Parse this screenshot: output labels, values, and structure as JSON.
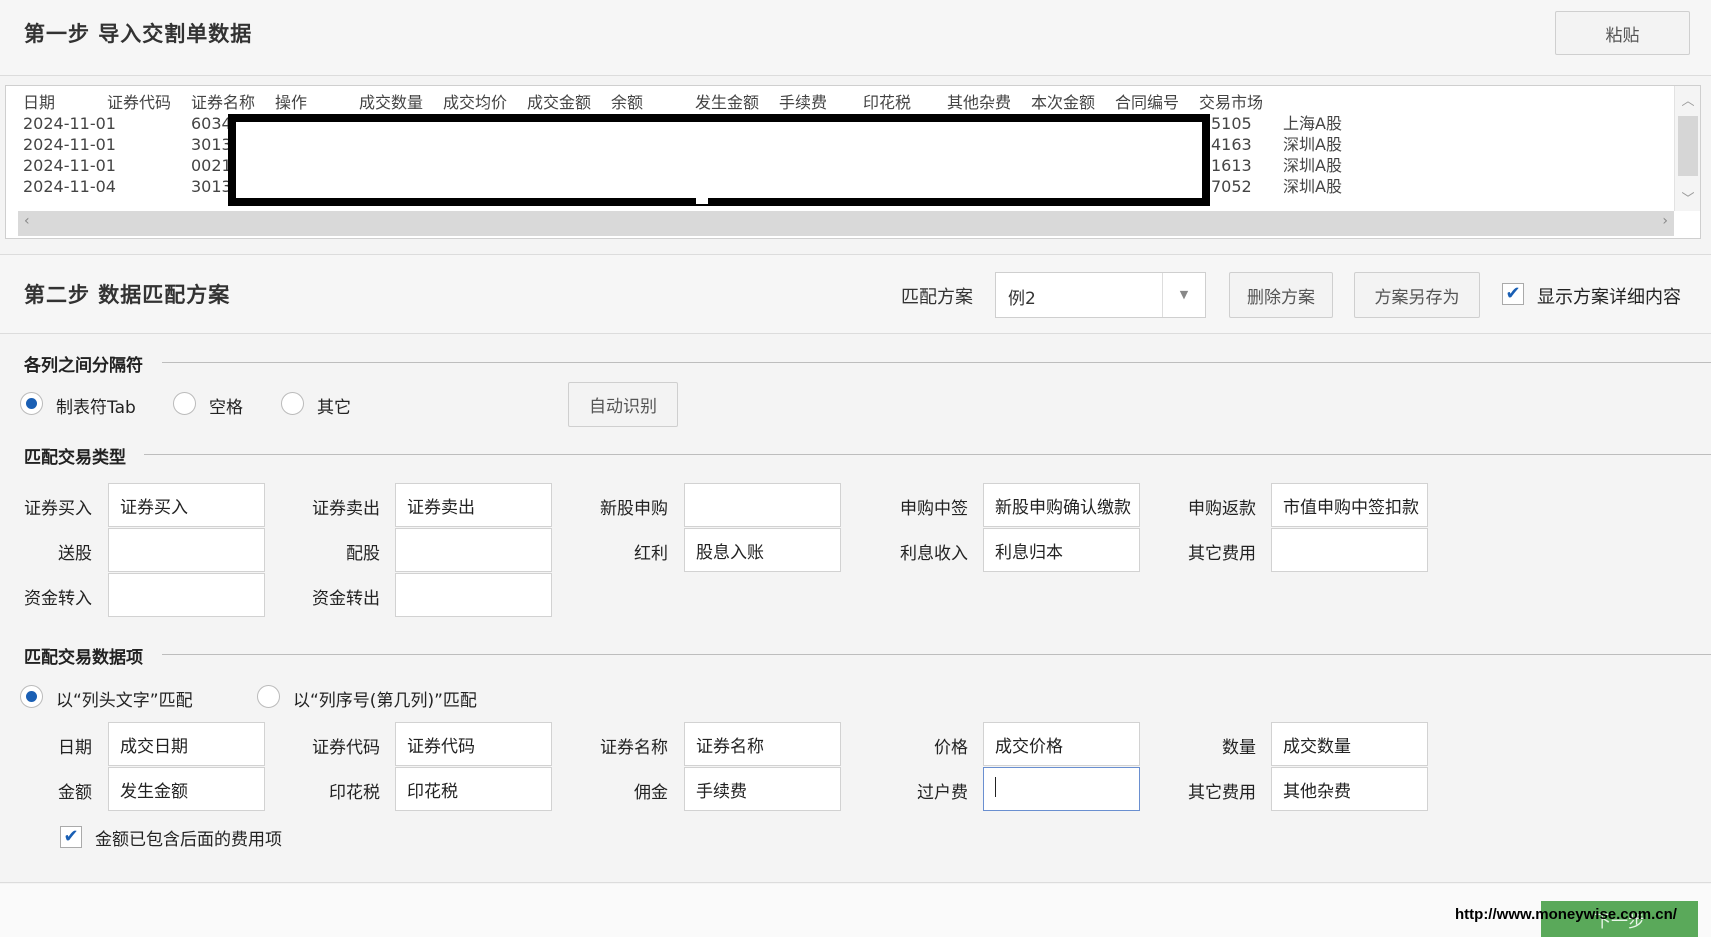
{
  "step1": {
    "title": "第一步 导入交割单数据",
    "paste_label": "粘贴",
    "columns": [
      "日期",
      "证券代码",
      "证券名称",
      "操作",
      "成交数量",
      "成交均价",
      "成交金额",
      "余额",
      "发生金额",
      "手续费",
      "印花税",
      "其他杂费",
      "本次金额",
      "合同编号",
      "交易市场"
    ],
    "rows": [
      {
        "date": "2024-11-01",
        "code": "6034",
        "contract": "5105",
        "market": "上海A股"
      },
      {
        "date": "2024-11-01",
        "code": "3013",
        "contract": "4163",
        "market": "深圳A股"
      },
      {
        "date": "2024-11-01",
        "code": "0021",
        "contract": "1613",
        "market": "深圳A股"
      },
      {
        "date": "2024-11-04",
        "code": "3013",
        "contract": "7052",
        "market": "深圳A股"
      }
    ]
  },
  "step2": {
    "title": "第二步 数据匹配方案",
    "scheme_label": "匹配方案",
    "scheme_value": "例2",
    "delete_label": "删除方案",
    "saveas_label": "方案另存为",
    "show_detail_label": "显示方案详细内容",
    "show_detail_checked": true
  },
  "separator": {
    "title": "各列之间分隔符",
    "options": [
      "制表符Tab",
      "空格",
      "其它"
    ],
    "selected": "制表符Tab",
    "auto_label": "自动识别"
  },
  "trade_types": {
    "title": "匹配交易类型",
    "fields": [
      {
        "label": "证券买入",
        "value": "证券买入"
      },
      {
        "label": "证券卖出",
        "value": "证券卖出"
      },
      {
        "label": "新股申购",
        "value": ""
      },
      {
        "label": "申购中签",
        "value": "新股申购确认缴款"
      },
      {
        "label": "申购返款",
        "value": "市值申购中签扣款"
      },
      {
        "label": "送股",
        "value": ""
      },
      {
        "label": "配股",
        "value": ""
      },
      {
        "label": "红利",
        "value": "股息入账"
      },
      {
        "label": "利息收入",
        "value": "利息归本"
      },
      {
        "label": "其它费用",
        "value": ""
      },
      {
        "label": "资金转入",
        "value": ""
      },
      {
        "label": "资金转出",
        "value": ""
      }
    ]
  },
  "data_items": {
    "title": "匹配交易数据项",
    "options": [
      "以“列头文字”匹配",
      "以“列序号(第几列)”匹配"
    ],
    "selected": "以“列头文字”匹配",
    "fields": [
      {
        "label": "日期",
        "value": "成交日期"
      },
      {
        "label": "证券代码",
        "value": "证券代码"
      },
      {
        "label": "证券名称",
        "value": "证券名称"
      },
      {
        "label": "价格",
        "value": "成交价格"
      },
      {
        "label": "数量",
        "value": "成交数量"
      },
      {
        "label": "金额",
        "value": "发生金额"
      },
      {
        "label": "印花税",
        "value": "印花税"
      },
      {
        "label": "佣金",
        "value": "手续费"
      },
      {
        "label": "过户费",
        "value": ""
      },
      {
        "label": "其它费用",
        "value": "其他杂费"
      }
    ],
    "include_fees_label": "金额已包含后面的费用项",
    "include_fees_checked": true
  },
  "footer": {
    "next_label": "下一步",
    "watermark": "http://www.moneywise.com.cn/"
  },
  "icons": {
    "scroll_up": "chevron-up-icon",
    "scroll_down": "chevron-down-icon",
    "scroll_left": "chevron-left-icon",
    "scroll_right": "chevron-right-icon",
    "dropdown": "caret-down-icon",
    "check": "check-icon"
  },
  "colors": {
    "accent": "#1a5fb4",
    "next_button": "#5aa95a"
  }
}
